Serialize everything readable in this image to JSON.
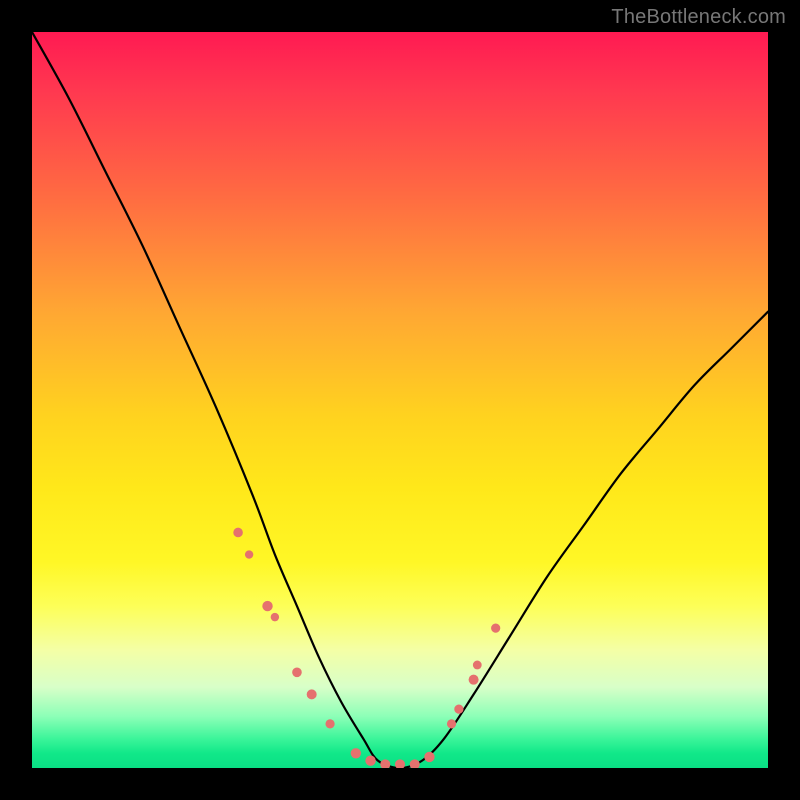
{
  "watermark": "TheBottleneck.com",
  "chart_data": {
    "type": "line",
    "title": "",
    "xlabel": "",
    "ylabel": "",
    "xlim": [
      0,
      100
    ],
    "ylim": [
      0,
      100
    ],
    "curve": {
      "name": "bottleneck-curve",
      "x": [
        0,
        5,
        10,
        15,
        20,
        25,
        30,
        33,
        36,
        39,
        42,
        45,
        47,
        50,
        53,
        56,
        60,
        65,
        70,
        75,
        80,
        85,
        90,
        95,
        100
      ],
      "y": [
        100,
        91,
        81,
        71,
        60,
        49,
        37,
        29,
        22,
        15,
        9,
        4,
        1,
        0,
        1,
        4,
        10,
        18,
        26,
        33,
        40,
        46,
        52,
        57,
        62
      ]
    },
    "markers": {
      "name": "highlighted-points",
      "color": "#e5716e",
      "x": [
        28,
        29.5,
        32,
        33,
        36,
        38,
        40.5,
        44,
        46,
        48,
        50,
        52,
        54,
        57,
        58,
        60,
        60.5,
        63
      ],
      "y": [
        32,
        29,
        22,
        20.5,
        13,
        10,
        6,
        2,
        1,
        0.5,
        0.5,
        0.5,
        1.5,
        6,
        8,
        12,
        14,
        19
      ],
      "r": [
        4.8,
        4.2,
        5.2,
        4.2,
        4.8,
        5.0,
        4.6,
        5.2,
        5.2,
        5.0,
        5.0,
        5.0,
        5.2,
        4.6,
        4.6,
        5.0,
        4.4,
        4.6
      ]
    },
    "colors": {
      "curve": "#000000",
      "marker": "#e5716e",
      "gradient_top": "#ff1a52",
      "gradient_bottom": "#0adf84",
      "frame": "#000000"
    }
  }
}
